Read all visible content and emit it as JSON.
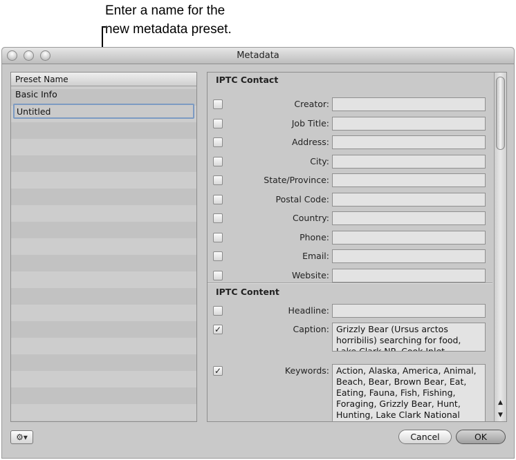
{
  "callout": {
    "line1": "Enter a name for the",
    "line2": "new metadata preset."
  },
  "window": {
    "title": "Metadata"
  },
  "presets": {
    "header": "Preset Name",
    "items": [
      "Basic Info"
    ],
    "editing": "Untitled"
  },
  "sections": [
    {
      "title": "IPTC Contact",
      "fields": [
        {
          "label": "Creator:",
          "value": "",
          "checked": false
        },
        {
          "label": "Job Title:",
          "value": "",
          "checked": false
        },
        {
          "label": "Address:",
          "value": "",
          "checked": false
        },
        {
          "label": "City:",
          "value": "",
          "checked": false
        },
        {
          "label": "State/Province:",
          "value": "",
          "checked": false
        },
        {
          "label": "Postal Code:",
          "value": "",
          "checked": false
        },
        {
          "label": "Country:",
          "value": "",
          "checked": false
        },
        {
          "label": "Phone:",
          "value": "",
          "checked": false
        },
        {
          "label": "Email:",
          "value": "",
          "checked": false
        },
        {
          "label": "Website:",
          "value": "",
          "checked": false
        }
      ]
    },
    {
      "title": "IPTC Content",
      "fields": [
        {
          "label": "Headline:",
          "value": "",
          "checked": false
        },
        {
          "label": "Caption:",
          "value": "Grizzly Bear (Ursus arctos horribilis) searching for food, Lake Clark NP, Cook Inlet",
          "checked": true
        },
        {
          "label": "Keywords:",
          "value": "Action, Alaska, America, Animal, Beach, Bear, Brown Bear, Eat, Eating, Fauna, Fish, Fishing, Foraging, Grizzly Bear, Hunt, Hunting, Lake Clark National",
          "checked": true
        }
      ]
    }
  ],
  "buttons": {
    "gear": "⚙▾",
    "cancel": "Cancel",
    "ok": "OK"
  },
  "check_glyph": "✓"
}
